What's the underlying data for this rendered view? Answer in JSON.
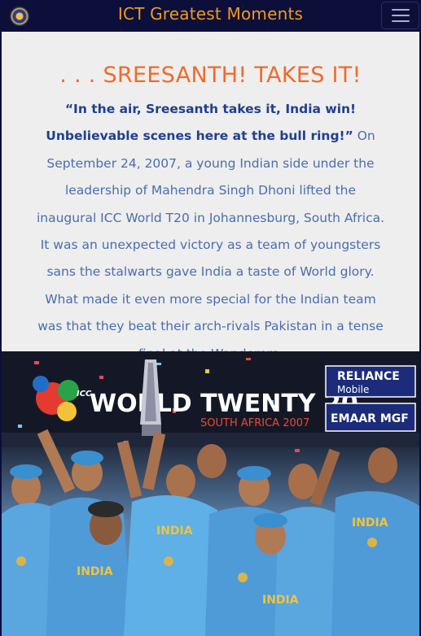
{
  "navbar": {
    "brand": "ICT Greatest Moments",
    "logo_icon": "bcci-logo-icon",
    "menu_icon": "hamburger-menu-icon"
  },
  "article": {
    "headline": ". . . SREESANTH! TAKES IT!",
    "quote": "“In the air, Sreesanth takes it, India win! Unbelievable scenes here at the bull ring!”",
    "body": " On September 24, 2007, a young Indian side under the leadership of Mahendra Singh Dhoni lifted the inaugural ICC World T20 in Johannesburg, South Africa. It was an unexpected victory as a team of youngsters sans the stalwarts gave India a taste of World glory. What made it even more special for the Indian team was that they beat their arch-rivals Pakistan in a tense final at the Wanderers."
  },
  "photo": {
    "banner_main": "WORLD TWENTY 20",
    "banner_icc": "ICC",
    "banner_sub": "SOUTH AFRICA 2007",
    "sponsor_1_line1": "RELIANCE",
    "sponsor_1_line2": "Mobile",
    "sponsor_2": "EMAAR MGF",
    "jersey_text": "INDIA"
  },
  "colors": {
    "navbar_bg": "#0b0f3a",
    "brand": "#f39a1f",
    "headline": "#f06a2b",
    "body_text": "#4a6db0",
    "quote_text": "#1f3f8f",
    "content_bg": "#eeeeee"
  }
}
